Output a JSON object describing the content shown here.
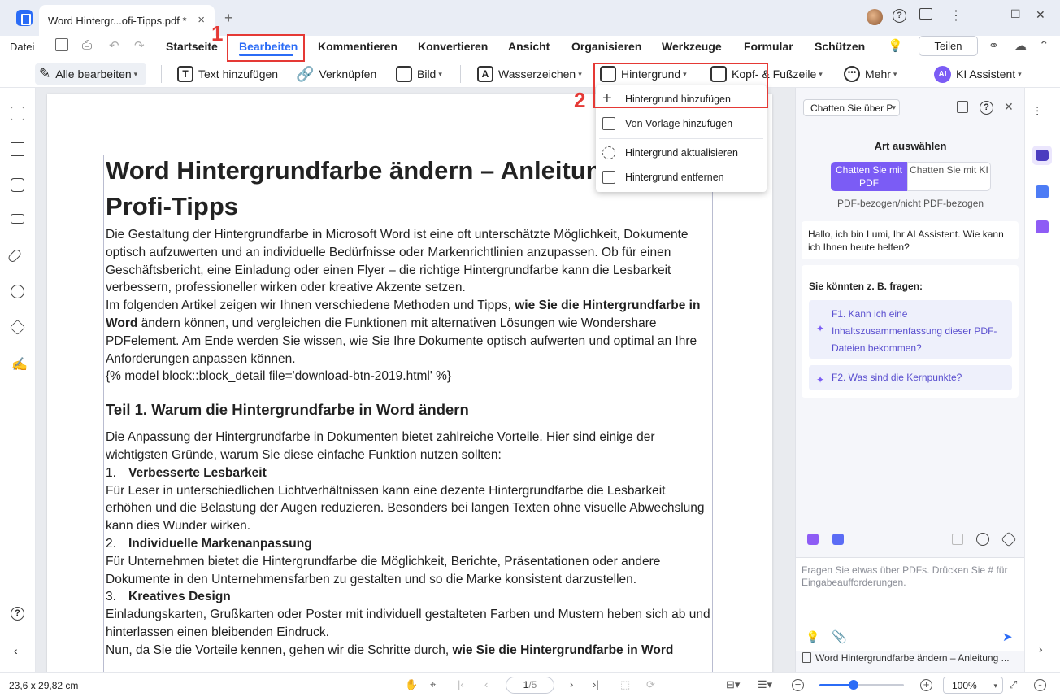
{
  "titlebar": {
    "tab_title": "Word  Hintergr...ofi-Tipps.pdf *",
    "close_glyph": "×",
    "new_tab_glyph": "+",
    "minimize_glyph": "—",
    "maximize_glyph": "☐",
    "close_window_glyph": "✕"
  },
  "menubar": {
    "datei": "Datei",
    "tabs": [
      "Startseite",
      "Bearbeiten",
      "Kommentieren",
      "Konvertieren",
      "Ansicht",
      "Organisieren",
      "Werkzeuge",
      "Formular",
      "Schützen"
    ],
    "active_tab": "Bearbeiten",
    "share_label": "Teilen"
  },
  "toolbar": {
    "alle_bearbeiten": "Alle bearbeiten",
    "text_hinzufuegen": "Text hinzufügen",
    "verknuepfen": "Verknüpfen",
    "bild": "Bild",
    "wasserzeichen": "Wasserzeichen",
    "hintergrund": "Hintergrund",
    "kopf_fusszeile": "Kopf- & Fußzeile",
    "mehr": "Mehr",
    "ki_assistent": "KI Assistent",
    "ki_badge": "AI"
  },
  "dropdown": {
    "items": [
      "Hintergrund hinzufügen",
      "Von Vorlage hinzufügen",
      "Hintergrund aktualisieren",
      "Hintergrund entfernen"
    ]
  },
  "annotations": {
    "marker_1": "1",
    "marker_2": "2"
  },
  "document": {
    "title": "Word Hintergrundfarbe ändern – Anleitung und Profi-Tipps",
    "p1": "Die Gestaltung der Hintergrundfarbe in Microsoft Word ist eine oft unterschätzte Möglichkeit, Dokumente optisch aufzuwerten und an individuelle Bedürfnisse oder Markenrichtlinien anzupassen. Ob für einen Geschäftsbericht, eine Einladung oder einen Flyer – die richtige Hintergrundfarbe kann die Lesbarkeit verbessern, professioneller wirken oder kreative Akzente setzen.",
    "p2_a": "Im folgenden Artikel zeigen wir Ihnen verschiedene Methoden und Tipps, ",
    "p2_b": "wie Sie die Hintergrundfarbe in Word",
    "p2_c": " ändern können, und vergleichen die Funktionen mit alternativen Lösungen wie Wondershare PDFelement. Am Ende werden Sie wissen, wie Sie Ihre Dokumente optisch aufwerten und optimal an Ihre Anforderungen anpassen können.",
    "p3": "{% model block::block_detail file='download-btn-2019.html' %}",
    "h2": "Teil 1. Warum die Hintergrundfarbe in Word ändern",
    "p4": "Die Anpassung der Hintergrundfarbe in Dokumenten bietet zahlreiche Vorteile. Hier sind einige der wichtigsten Gründe, warum Sie diese einfache Funktion nutzen sollten:",
    "items": [
      {
        "num": "1.",
        "title": "Verbesserte Lesbarkeit",
        "text": "Für Leser in unterschiedlichen Lichtverhältnissen kann eine dezente Hintergrundfarbe die Lesbarkeit erhöhen und die Belastung der Augen reduzieren. Besonders bei langen Texten ohne visuelle Abwechslung kann dies Wunder wirken."
      },
      {
        "num": "2.",
        "title": "Individuelle Markenanpassung",
        "text": "Für Unternehmen bietet die Hintergrundfarbe die Möglichkeit, Berichte, Präsentationen oder andere Dokumente in den Unternehmensfarben zu gestalten und so die Marke konsistent darzustellen."
      },
      {
        "num": "3.",
        "title": "Kreatives Design",
        "text": "Einladungskarten, Grußkarten oder Poster mit individuell gestalteten Farben und Mustern heben sich ab und hinterlassen einen bleibenden Eindruck."
      }
    ],
    "p5_a": "Nun, da Sie die Vorteile kennen, gehen wir die Schritte durch, ",
    "p5_b": "wie Sie die Hintergrundfarbe in Word"
  },
  "ai_panel": {
    "chat_select": "Chatten Sie über P",
    "art_title": "Art auswählen",
    "seg_pdf": "Chatten Sie mit PDF",
    "seg_ki": "Chatten Sie mit KI",
    "pdf_bezogen": "PDF-bezogen/nicht PDF-bezogen",
    "greeting": "Hallo, ich bin Lumi, Ihr AI Assistent. Wie kann ich Ihnen heute helfen?",
    "suggest_title": "Sie könnten z. B. fragen:",
    "suggestions": [
      "F1. Kann ich eine Inhaltszusammenfassung dieser PDF-Dateien bekommen?",
      "F2. Was sind die Kernpunkte?"
    ],
    "input_placeholder": "Fragen Sie etwas über PDFs. Drücken Sie # für Eingabeaufforderungen.",
    "doc_ref": "Word Hintergrundfarbe ändern – Anleitung ..."
  },
  "statusbar": {
    "page_size": "23,6 x 29,82 cm",
    "page_current": "1",
    "page_total": "/5",
    "zoom": "100%",
    "zoom_level_fraction": 0.4
  },
  "colors": {
    "accent": "#2b6cf6",
    "ai_purple": "#7b5cf5",
    "annotation_red": "#e53935"
  }
}
